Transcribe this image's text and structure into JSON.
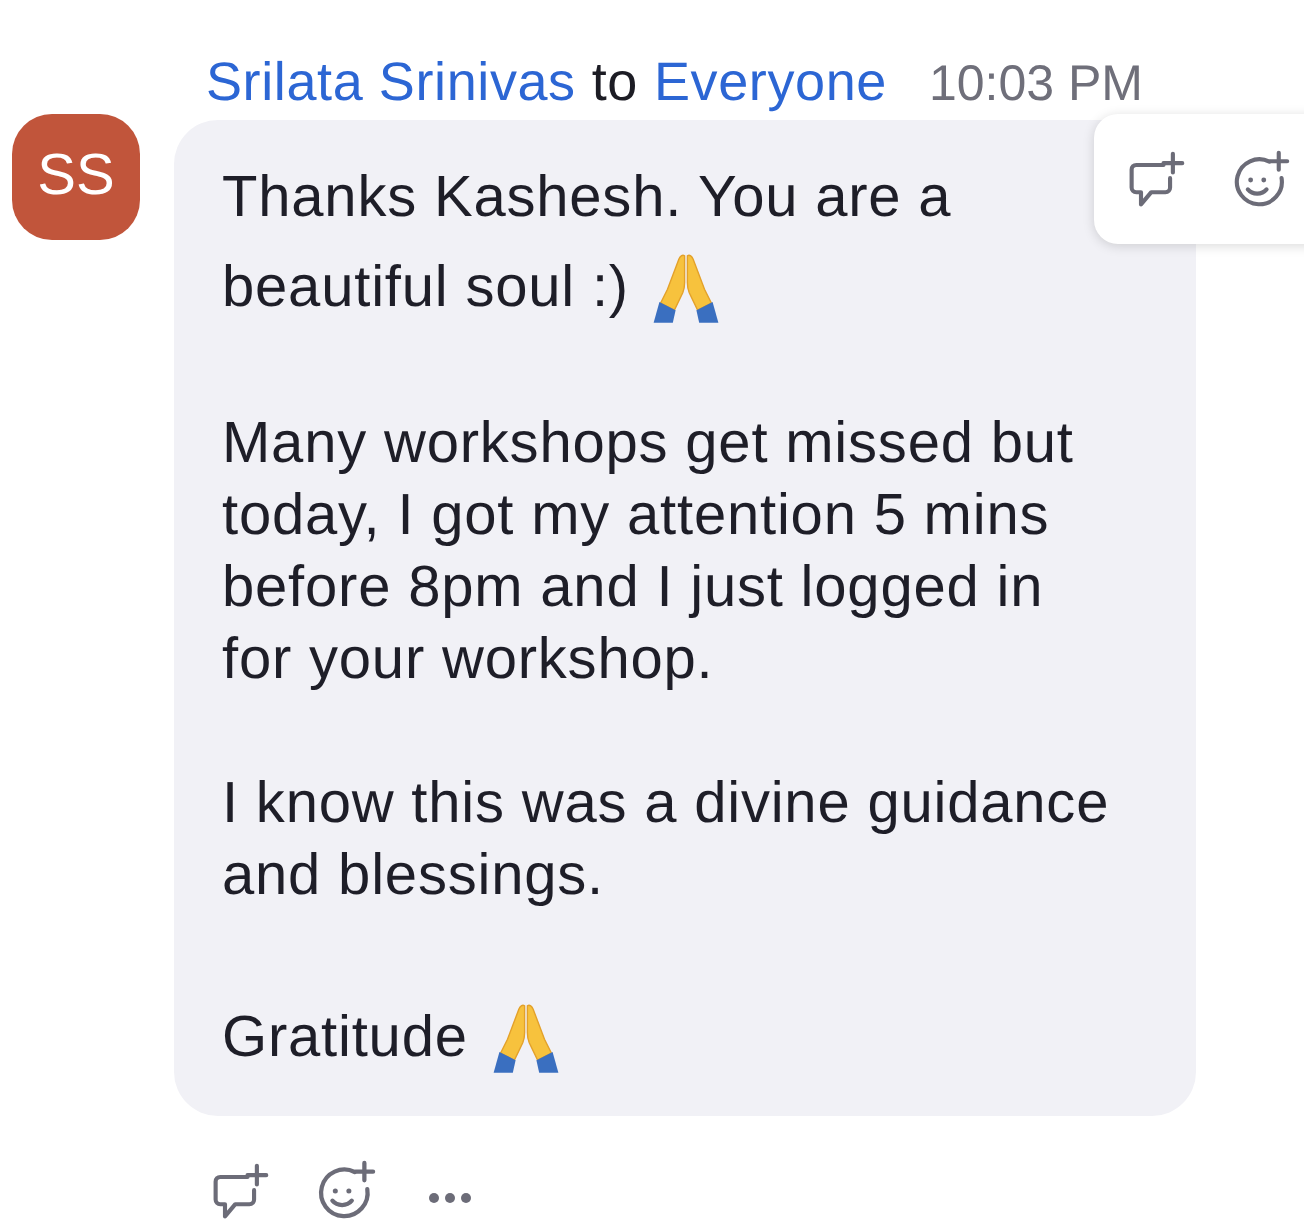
{
  "message": {
    "sender": "Srilata Srinivas",
    "connector": "to",
    "recipient": "Everyone",
    "time": "10:03 PM",
    "avatar_initials": "SS",
    "paragraphs": [
      {
        "lines": [
          "Thanks Kashesh. You are a",
          "beautiful soul :)"
        ],
        "emoji_after": true
      },
      {
        "lines": [
          "Many workshops get missed but",
          "today, I got my attention 5 mins",
          "before 8pm and I just logged in",
          "for your workshop."
        ]
      },
      {
        "lines": [
          "I know this was a divine guidance",
          "and blessings."
        ]
      },
      {
        "lines": [
          "Gratitude"
        ],
        "emoji_after": true
      }
    ]
  }
}
